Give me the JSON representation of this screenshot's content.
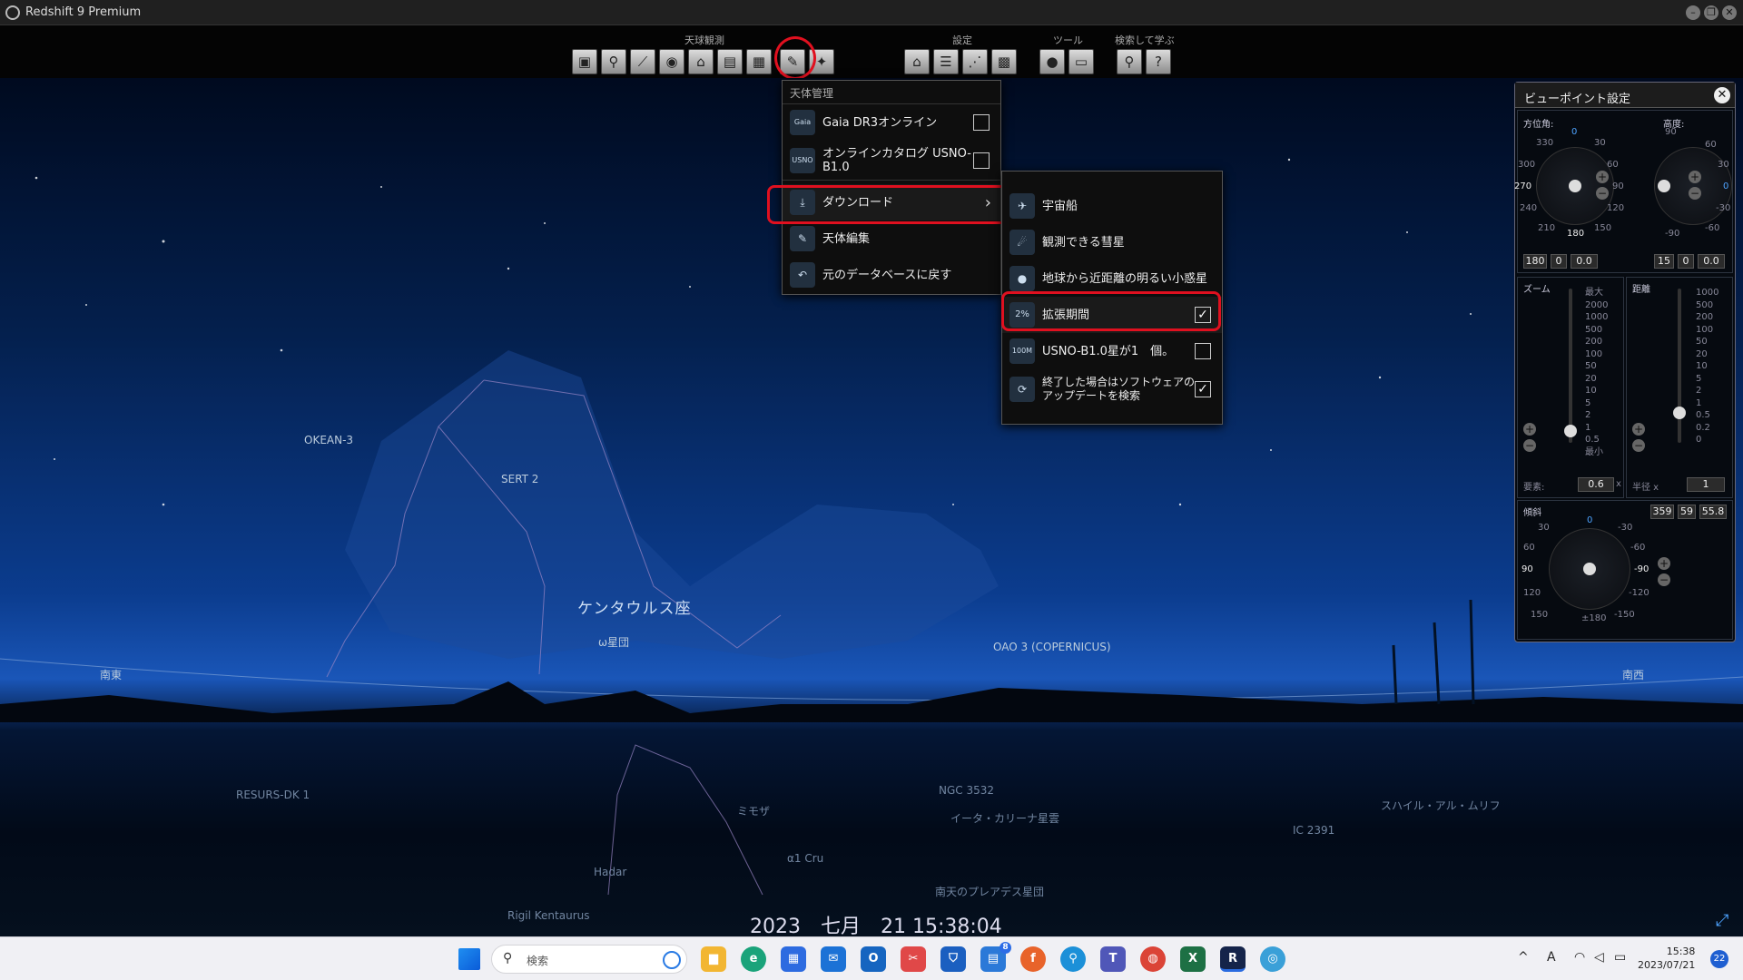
{
  "window": {
    "title": "Redshift 9 Premium"
  },
  "toolbar": {
    "groups": {
      "sky_obs": "天球観測",
      "settings": "設定",
      "tools": "ツール",
      "search_learn": "検索して学ぶ"
    }
  },
  "object_menu": {
    "header": "天体管理",
    "items": [
      {
        "icon_text": "Gaia",
        "label": "Gaia DR3オンライン",
        "checked": false
      },
      {
        "icon_text": "USNO",
        "label": "オンラインカタログ USNO-B1.0",
        "checked": false
      },
      {
        "label": "ダウンロード",
        "has_submenu": true,
        "selected": true
      },
      {
        "label": "天体編集"
      },
      {
        "label": "元のデータベースに戻す"
      }
    ]
  },
  "download_submenu": {
    "items": [
      {
        "label": "宇宙船"
      },
      {
        "label": "観測できる彗星"
      },
      {
        "label": "地球から近距離の明るい小惑星"
      },
      {
        "icon_text": "2%",
        "label": "拡張期間",
        "checked": true,
        "selected": true
      },
      {
        "icon_text": "100M",
        "label": "USNO-B1.0星が1　個。",
        "checked": false
      },
      {
        "label": "終了した場合はソフトウェアのアップデートを検索",
        "checked": true
      }
    ]
  },
  "sky": {
    "constellation": "ケンタウルス座",
    "labels": [
      "OKEAN-3",
      "SERT 2",
      "ω星団",
      "OAO 3 (COPERNICUS)",
      "南東",
      "南西",
      "RESURS-DK 1",
      "ミモザ",
      "NGC 3532",
      "イータ・カリーナ星雲",
      "スハイル・アル・ムリフ",
      "IC 2391",
      "Hadar",
      "α1 Cru",
      "南天のプレアデス星団",
      "Rigil Kentaurus"
    ],
    "datetime": "2023　七月　21 15:38:04"
  },
  "viewpoint_panel": {
    "title": "ビューポイント設定",
    "azimuth": {
      "label": "方位角:",
      "ticks": [
        "0",
        "30",
        "60",
        "90",
        "120",
        "150",
        "180",
        "210",
        "240",
        "270",
        "300",
        "330"
      ],
      "values": [
        "180",
        "0",
        "0.0"
      ]
    },
    "altitude": {
      "label": "高度:",
      "ticks": [
        "90",
        "60",
        "30",
        "0",
        "-30",
        "-60",
        "-90"
      ],
      "values": [
        "15",
        "0",
        "0.0"
      ]
    },
    "zoom": {
      "label": "ズーム",
      "scale": [
        "最大",
        "2000",
        "1000",
        "500",
        "200",
        "100",
        "50",
        "20",
        "10",
        "5",
        "2",
        "1",
        "0.5",
        "最小"
      ],
      "factor_label": "要素:",
      "factor_value": "0.6",
      "factor_unit": "x"
    },
    "distance": {
      "label": "距離",
      "scale": [
        "1000",
        "500",
        "200",
        "100",
        "50",
        "20",
        "10",
        "5",
        "2",
        "1",
        "0.5",
        "0.2",
        "0"
      ],
      "radius_label": "半径 x",
      "radius_value": "1"
    },
    "tilt": {
      "label": "傾斜",
      "values": [
        "359",
        "59",
        "55.8"
      ],
      "ticks": [
        "0",
        "-30",
        "-60",
        "-90",
        "-120",
        "-150",
        "±180",
        "150",
        "120",
        "90",
        "60",
        "30"
      ]
    }
  },
  "taskbar": {
    "search_placeholder": "検索",
    "clock_time": "15:38",
    "clock_date": "2023/07/21",
    "notification_count": "22",
    "teams_badge": "8",
    "ime": "A"
  }
}
